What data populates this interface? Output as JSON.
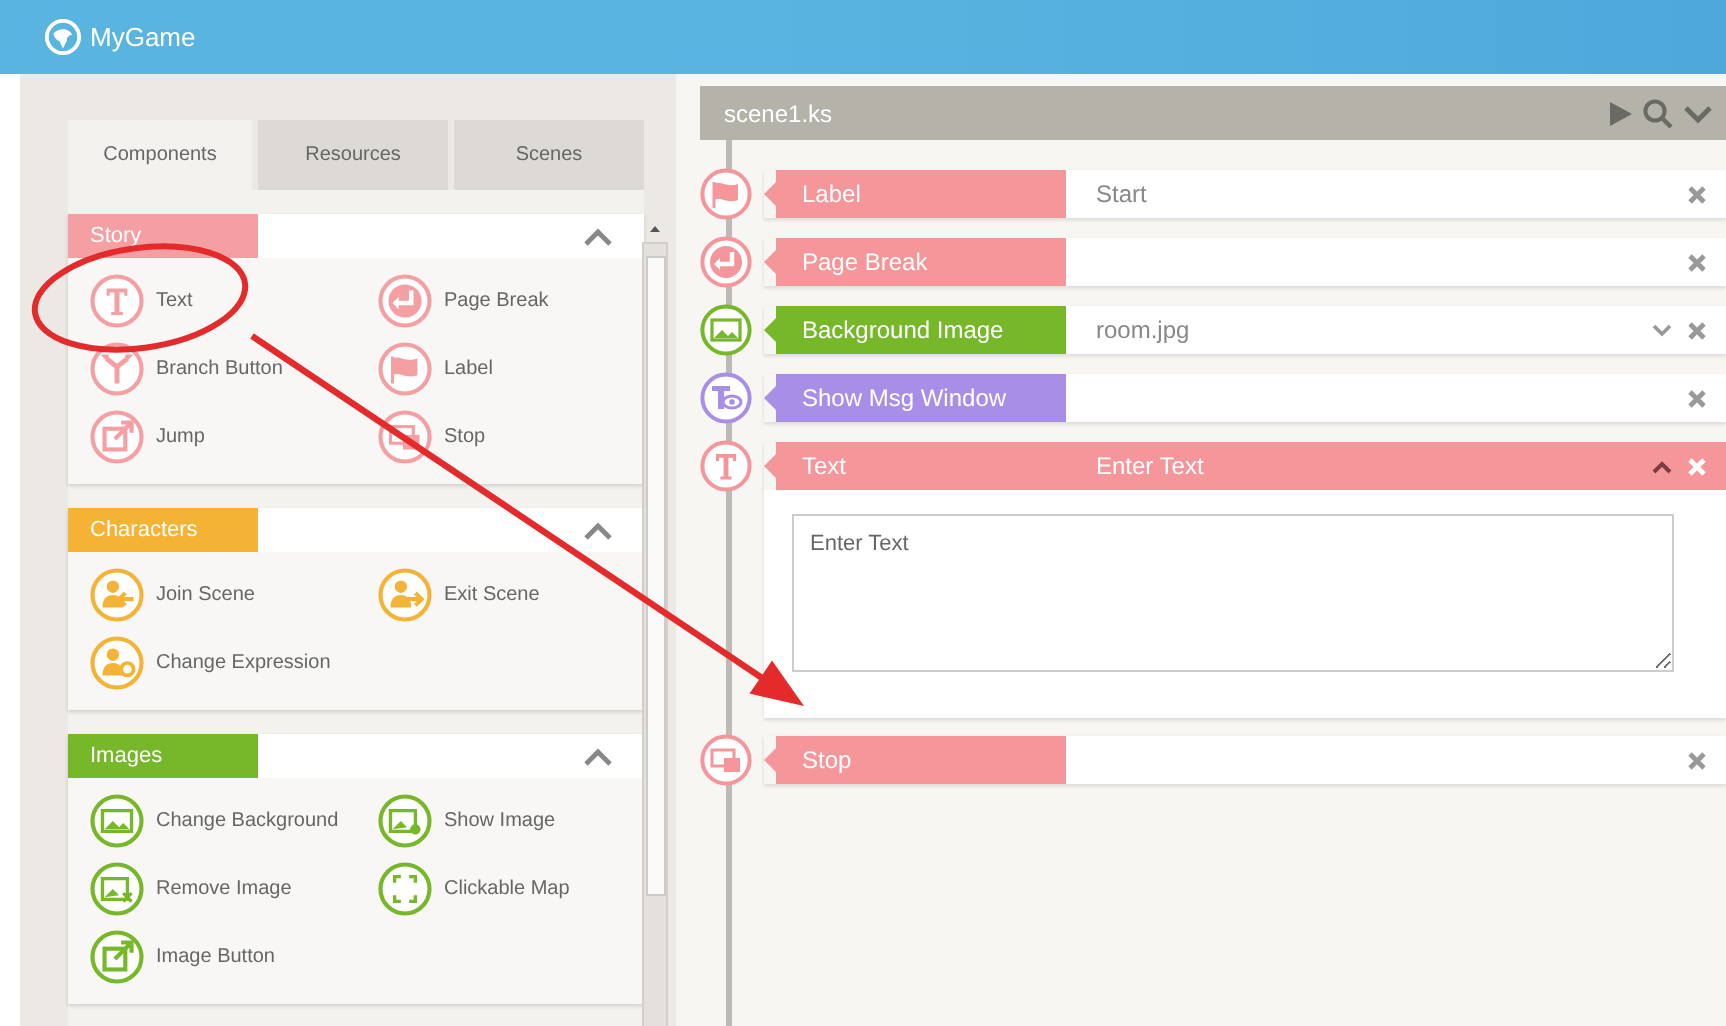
{
  "app": {
    "title": "MyGame"
  },
  "tabs": [
    {
      "label": "Components",
      "selected": true
    },
    {
      "label": "Resources",
      "selected": false
    },
    {
      "label": "Scenes",
      "selected": false
    }
  ],
  "sections": [
    {
      "title": "Story",
      "color": "#f4a0a3",
      "expanded": true,
      "items": [
        {
          "label": "Text",
          "kind": "text"
        },
        {
          "label": "Page Break",
          "kind": "page-break"
        },
        {
          "label": "Branch Button",
          "kind": "branch"
        },
        {
          "label": "Label",
          "kind": "label"
        },
        {
          "label": "Jump",
          "kind": "jump"
        },
        {
          "label": "Stop",
          "kind": "stop"
        }
      ]
    },
    {
      "title": "Characters",
      "color": "#f5b335",
      "expanded": true,
      "items": [
        {
          "label": "Join Scene",
          "kind": "join"
        },
        {
          "label": "Exit Scene",
          "kind": "exit"
        },
        {
          "label": "Change Expression",
          "kind": "expression"
        }
      ]
    },
    {
      "title": "Images",
      "color": "#76b82a",
      "expanded": true,
      "items": [
        {
          "label": "Change Background",
          "kind": "background"
        },
        {
          "label": "Show Image",
          "kind": "show-image"
        },
        {
          "label": "Remove Image",
          "kind": "remove-image"
        },
        {
          "label": "Clickable Map",
          "kind": "map"
        },
        {
          "label": "Image Button",
          "kind": "image-button"
        }
      ]
    }
  ],
  "editor": {
    "file": "scene1.ks",
    "rows": [
      {
        "kind": "label",
        "label": "Label",
        "color": "#f4969a",
        "value": "Start",
        "expanded": false
      },
      {
        "kind": "page-break",
        "label": "Page Break",
        "color": "#f4969a",
        "expanded": false
      },
      {
        "kind": "background",
        "label": "Background Image",
        "color": "#76b82a",
        "value": "room.jpg",
        "dropdown": true,
        "expanded": false
      },
      {
        "kind": "msg-window",
        "label": "Show Msg Window",
        "color": "#a98ee8",
        "expanded": false
      },
      {
        "kind": "text",
        "label": "Text",
        "color": "#f4969a",
        "summary": "Enter Text",
        "placeholder": "Enter Text",
        "expanded": true
      },
      {
        "kind": "stop",
        "label": "Stop",
        "color": "#f4969a",
        "expanded": false
      }
    ]
  },
  "annotations": [
    {
      "kind": "ellipse"
    },
    {
      "kind": "arrow"
    }
  ]
}
